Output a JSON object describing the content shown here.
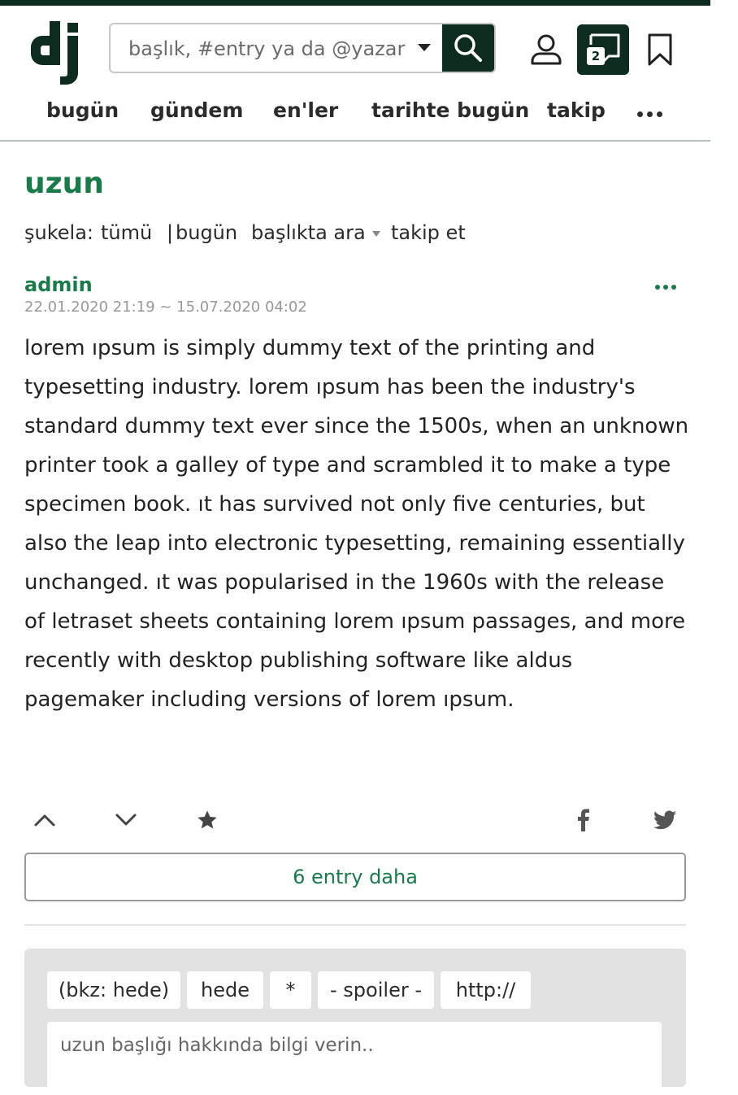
{
  "header": {
    "logo_text": "dj",
    "search_placeholder": "başlık, #entry ya da @yazar",
    "message_count": "2"
  },
  "nav": {
    "items": [
      {
        "label": "bugün"
      },
      {
        "label": "gündem"
      },
      {
        "label": "en'ler"
      },
      {
        "label": "tarihte bugün"
      },
      {
        "label": "takip"
      }
    ]
  },
  "topic": {
    "title": "uzun",
    "sukela_label": "şukela:",
    "sukela_all": "tümü",
    "separator": "|",
    "sukela_today": "bugün",
    "search_in_topic": "başlıkta ara",
    "follow": "takip et"
  },
  "entry": {
    "author": "admin",
    "date": "22.01.2020 21:19 ~ 15.07.2020 04:02",
    "content": "lorem ıpsum is simply dummy text of the printing and typesetting industry. lorem ıpsum has been the industry's standard dummy text ever since the 1500s, when an unknown printer took a galley of type and scrambled it to make a type specimen book. ıt has survived not only five centuries, but also the leap into electronic typesetting, remaining essentially unchanged. ıt was popularised in the 1960s with the release of letraset sheets containing lorem ıpsum passages, and more recently with desktop publishing software like aldus pagemaker including versions of lorem ıpsum."
  },
  "more_entries": "6 entry daha",
  "editor": {
    "buttons": [
      "(bkz: hede)",
      "hede",
      "*",
      "- spoiler -",
      "http://"
    ],
    "placeholder": "uzun başlığı hakkında bilgi verin.."
  },
  "colors": {
    "brand_dark": "#0d2b1f",
    "brand_green": "#1a7a4a"
  }
}
